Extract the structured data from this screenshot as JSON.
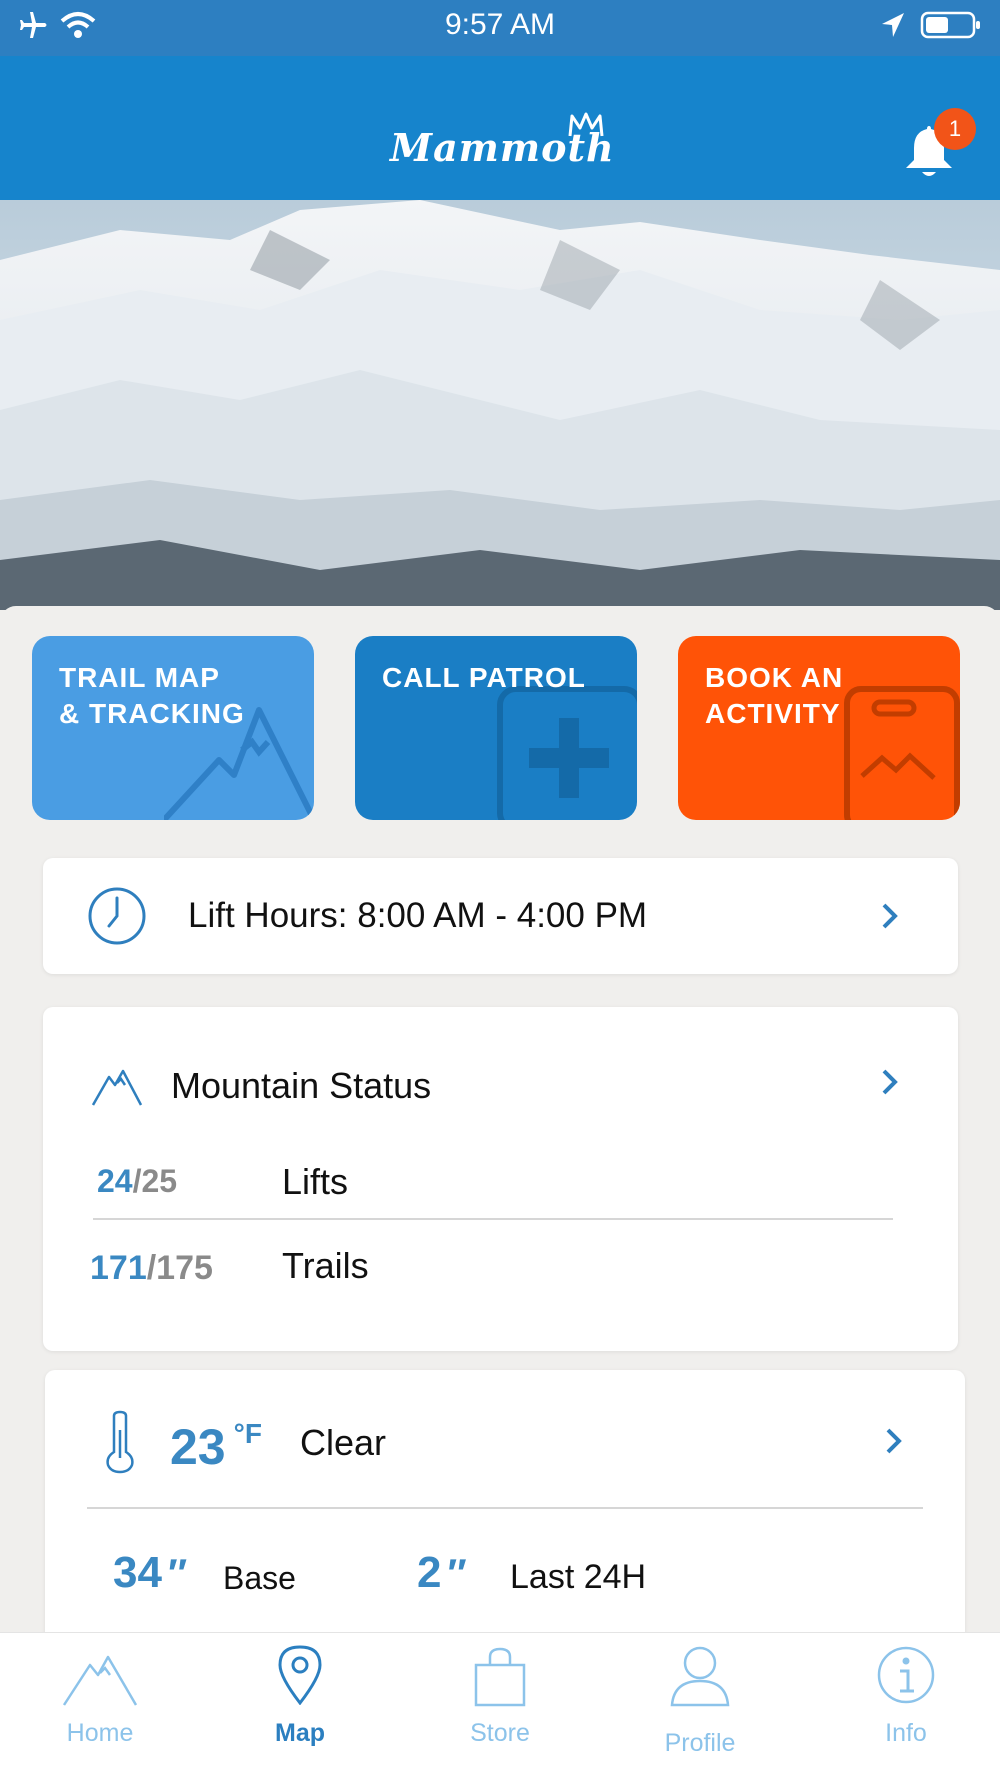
{
  "status_bar": {
    "time": "9:57 AM"
  },
  "header": {
    "logo_text": "Mammoth",
    "notification_count": "1"
  },
  "actions": [
    {
      "label": "TRAIL MAP\n& TRACKING",
      "color": "#4a9de3"
    },
    {
      "label": "CALL PATROL",
      "color": "#1a7ec5"
    },
    {
      "label": "BOOK AN\nACTIVITY",
      "color": "#ff5307"
    }
  ],
  "lift_hours": {
    "label": "Lift Hours: 8:00 AM - 4:00 PM"
  },
  "mountain_status": {
    "title": "Mountain Status",
    "lifts": {
      "open": "24",
      "total": "/25",
      "label": "Lifts"
    },
    "trails": {
      "open": "171",
      "total": "/175",
      "label": "Trails"
    }
  },
  "weather": {
    "temperature": "23",
    "unit": "°F",
    "condition": "Clear",
    "base": {
      "value": "34",
      "unit": "″",
      "label": "Base"
    },
    "last24": {
      "value": "2",
      "unit": "″",
      "label": "Last 24H"
    }
  },
  "tabs": [
    {
      "label": "Home",
      "icon": "mountain-icon"
    },
    {
      "label": "Map",
      "icon": "map-pin-icon",
      "active": true
    },
    {
      "label": "Store",
      "icon": "shopping-bag-icon"
    },
    {
      "label": "Profile",
      "icon": "person-icon"
    },
    {
      "label": "Info",
      "icon": "info-icon"
    }
  ],
  "colors": {
    "header_blue": "#1684cc",
    "status_blue": "#2d7fc1",
    "accent_blue": "#3a88c2",
    "orange": "#ff5307"
  }
}
